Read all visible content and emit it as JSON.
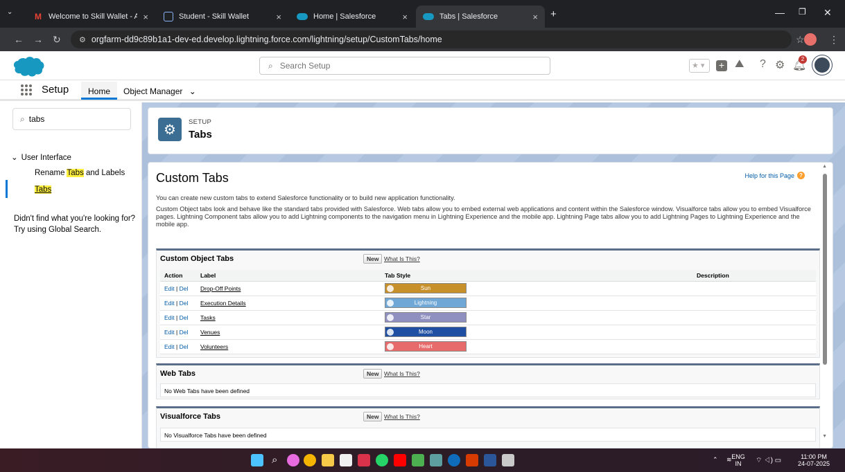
{
  "browser": {
    "tabs": [
      {
        "title": "Welcome to Skill Wallet - A One",
        "icon": "gmail-icon"
      },
      {
        "title": "Student - Skill Wallet",
        "icon": "skill-wallet-icon"
      },
      {
        "title": "Home | Salesforce",
        "icon": "salesforce-icon"
      },
      {
        "title": "Tabs | Salesforce",
        "icon": "salesforce-icon",
        "active": true
      }
    ],
    "url": "orgfarm-dd9c89b1a1-dev-ed.develop.lightning.force.com/lightning/setup/CustomTabs/home"
  },
  "header": {
    "search_placeholder": "Search Setup",
    "notification_count": "2"
  },
  "setup_nav": {
    "app_name": "Setup",
    "home_tab": "Home",
    "object_manager_tab": "Object Manager"
  },
  "sidebar": {
    "quick_find_value": "tabs",
    "group": "User Interface",
    "rename_item_pre": "Rename ",
    "rename_item_hl": "Tabs",
    "rename_item_post": " and Labels",
    "tabs_item": "Tabs",
    "help_line1": "Didn't find what you're looking for?",
    "help_line2": "Try using Global Search."
  },
  "page_header": {
    "eyebrow": "SETUP",
    "title": "Tabs"
  },
  "content": {
    "title": "Custom Tabs",
    "help_link": "Help for this Page",
    "intro": "You can create new custom tabs to extend Salesforce functionality or to build new application functionality.",
    "description": "Custom Object tabs look and behave like the standard tabs provided with Salesforce. Web tabs allow you to embed external web applications and content within the Salesforce window. Visualforce tabs allow you to embed Visualforce pages. Lightning Component tabs allow you to add Lightning components to the navigation menu in Lightning Experience and the mobile app. Lightning Page tabs allow you to add Lightning Pages to Lightning Experience and the mobile app.",
    "new_label": "New",
    "what_label": "What Is This?",
    "custom_object_tabs": {
      "title": "Custom Object Tabs",
      "columns": [
        "Action",
        "Label",
        "Tab Style",
        "Description"
      ],
      "edit_label": "Edit",
      "del_label": "Del",
      "rows": [
        {
          "label": "Drop-Off Points",
          "style": "Sun",
          "color": "#c8902a"
        },
        {
          "label": "Execution Details",
          "style": "Lightning",
          "color": "#6fa7d6"
        },
        {
          "label": "Tasks",
          "style": "Star",
          "color": "#8f8fc0"
        },
        {
          "label": "Venues",
          "style": "Moon",
          "color": "#1f4fa3"
        },
        {
          "label": "Volunteers",
          "style": "Heart",
          "color": "#e86b6b"
        }
      ]
    },
    "web_tabs": {
      "title": "Web Tabs",
      "empty": "No Web Tabs have been defined"
    },
    "visualforce_tabs": {
      "title": "Visualforce Tabs",
      "empty": "No Visualforce Tabs have been defined"
    }
  },
  "taskbar": {
    "lang_line1": "ENG",
    "lang_line2": "IN",
    "time": "11:00 PM",
    "date": "24-07-2025"
  }
}
